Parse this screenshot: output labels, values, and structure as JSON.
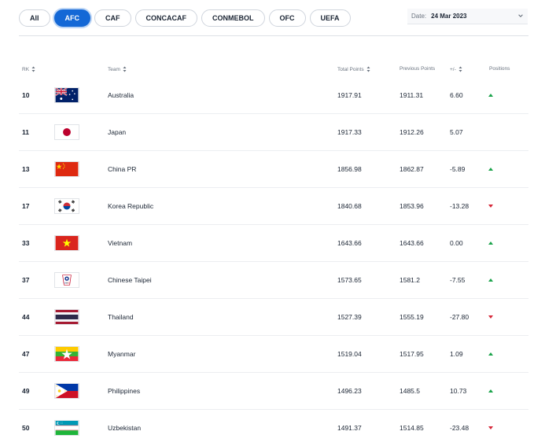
{
  "filters": {
    "tabs": [
      {
        "label": "All",
        "active": false
      },
      {
        "label": "AFC",
        "active": true
      },
      {
        "label": "CAF",
        "active": false
      },
      {
        "label": "CONCACAF",
        "active": false
      },
      {
        "label": "CONMEBOL",
        "active": false
      },
      {
        "label": "OFC",
        "active": false
      },
      {
        "label": "UEFA",
        "active": false
      }
    ],
    "date_label": "Date:",
    "date_value": "24 Mar 2023"
  },
  "table": {
    "headers": {
      "rank": "RK",
      "team": "Team",
      "total": "Total Points",
      "previous": "Previous Points",
      "diff": "+/-",
      "positions": "Positions"
    },
    "rows": [
      {
        "rank": "10",
        "team": "Australia",
        "flag": "australia-flag-icon",
        "total": "1917.91",
        "previous": "1911.31",
        "diff": "6.60",
        "movement": "up"
      },
      {
        "rank": "11",
        "team": "Japan",
        "flag": "japan-flag-icon",
        "total": "1917.33",
        "previous": "1912.26",
        "diff": "5.07",
        "movement": "none"
      },
      {
        "rank": "13",
        "team": "China PR",
        "flag": "china-flag-icon",
        "total": "1856.98",
        "previous": "1862.87",
        "diff": "-5.89",
        "movement": "up"
      },
      {
        "rank": "17",
        "team": "Korea Republic",
        "flag": "korea-flag-icon",
        "total": "1840.68",
        "previous": "1853.96",
        "diff": "-13.28",
        "movement": "down"
      },
      {
        "rank": "33",
        "team": "Vietnam",
        "flag": "vietnam-flag-icon",
        "total": "1643.66",
        "previous": "1643.66",
        "diff": "0.00",
        "movement": "up"
      },
      {
        "rank": "37",
        "team": "Chinese Taipei",
        "flag": "chinese-taipei-flag-icon",
        "total": "1573.65",
        "previous": "1581.2",
        "diff": "-7.55",
        "movement": "up"
      },
      {
        "rank": "44",
        "team": "Thailand",
        "flag": "thailand-flag-icon",
        "total": "1527.39",
        "previous": "1555.19",
        "diff": "-27.80",
        "movement": "down"
      },
      {
        "rank": "47",
        "team": "Myanmar",
        "flag": "myanmar-flag-icon",
        "total": "1519.04",
        "previous": "1517.95",
        "diff": "1.09",
        "movement": "up"
      },
      {
        "rank": "49",
        "team": "Philippines",
        "flag": "philippines-flag-icon",
        "total": "1496.23",
        "previous": "1485.5",
        "diff": "10.73",
        "movement": "up"
      },
      {
        "rank": "50",
        "team": "Uzbekistan",
        "flag": "uzbekistan-flag-icon",
        "total": "1491.37",
        "previous": "1514.85",
        "diff": "-23.48",
        "movement": "down"
      }
    ]
  },
  "colors": {
    "accent": "#1468d6",
    "up": "#1aa34a",
    "down": "#d62839"
  }
}
